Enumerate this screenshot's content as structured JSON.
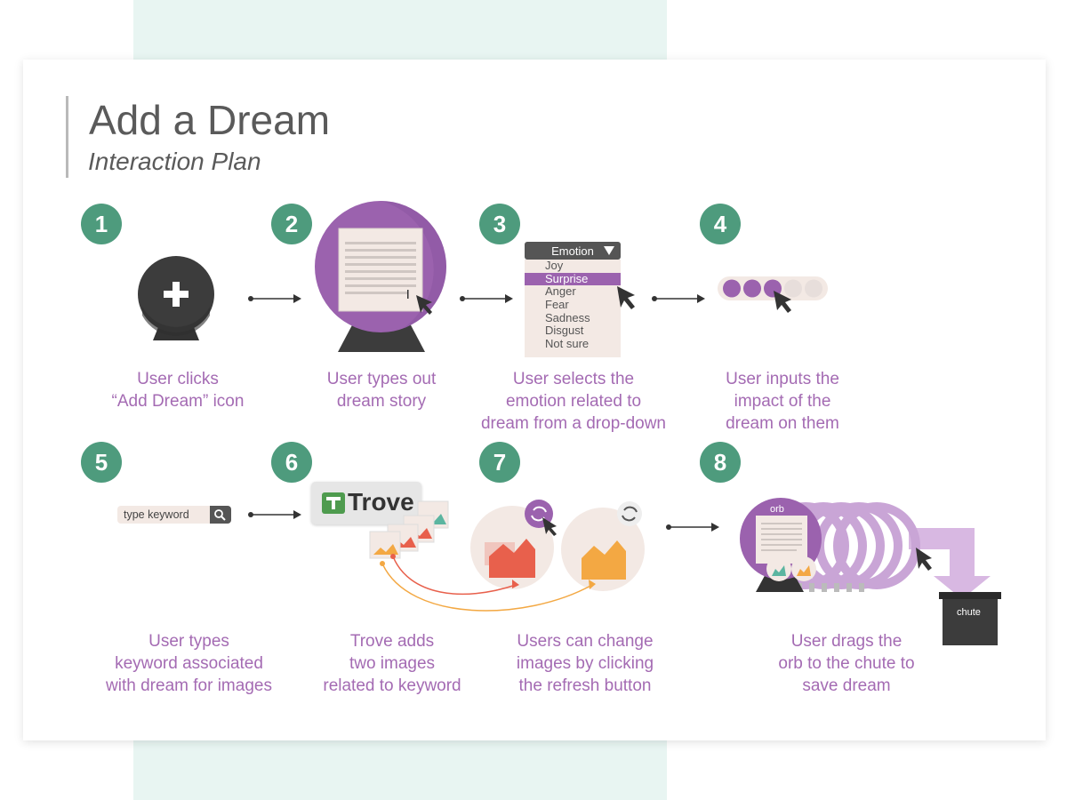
{
  "title": "Add a Dream",
  "subtitle": "Interaction Plan",
  "colors": {
    "badge": "#4e9b7d",
    "caption": "#a46bb3",
    "purple": "#9b62ae",
    "dark": "#3c3c3c",
    "paper": "#f3e9e4"
  },
  "steps": [
    {
      "num": "1",
      "caption": [
        "User clicks",
        "“Add Dream” icon"
      ]
    },
    {
      "num": "2",
      "caption": [
        "User types out",
        "dream story"
      ]
    },
    {
      "num": "3",
      "caption": [
        "User selects the",
        "emotion related to",
        "dream from a drop-down"
      ]
    },
    {
      "num": "4",
      "caption": [
        "User inputs the",
        "impact of the",
        "dream on them"
      ]
    },
    {
      "num": "5",
      "caption": [
        "User types",
        "keyword associated",
        "with dream for images"
      ]
    },
    {
      "num": "6",
      "caption": [
        "Trove adds",
        "two images",
        "related to keyword"
      ]
    },
    {
      "num": "7",
      "caption": [
        "Users can change",
        "images by clicking",
        "the refresh button"
      ]
    },
    {
      "num": "8",
      "caption": [
        "User drags the",
        "orb to the chute to",
        "save dream"
      ]
    }
  ],
  "dropdown": {
    "label": "Emotion",
    "options": [
      "Joy",
      "Surprise",
      "Anger",
      "Fear",
      "Sadness",
      "Disgust",
      "Not sure"
    ],
    "selected": "Surprise"
  },
  "impact": {
    "filled": 3,
    "total": 5
  },
  "search": {
    "placeholder": "type keyword"
  },
  "trove": {
    "logo_text": "Trove"
  },
  "orb": {
    "label": "orb"
  },
  "chute": {
    "label": "chute"
  }
}
